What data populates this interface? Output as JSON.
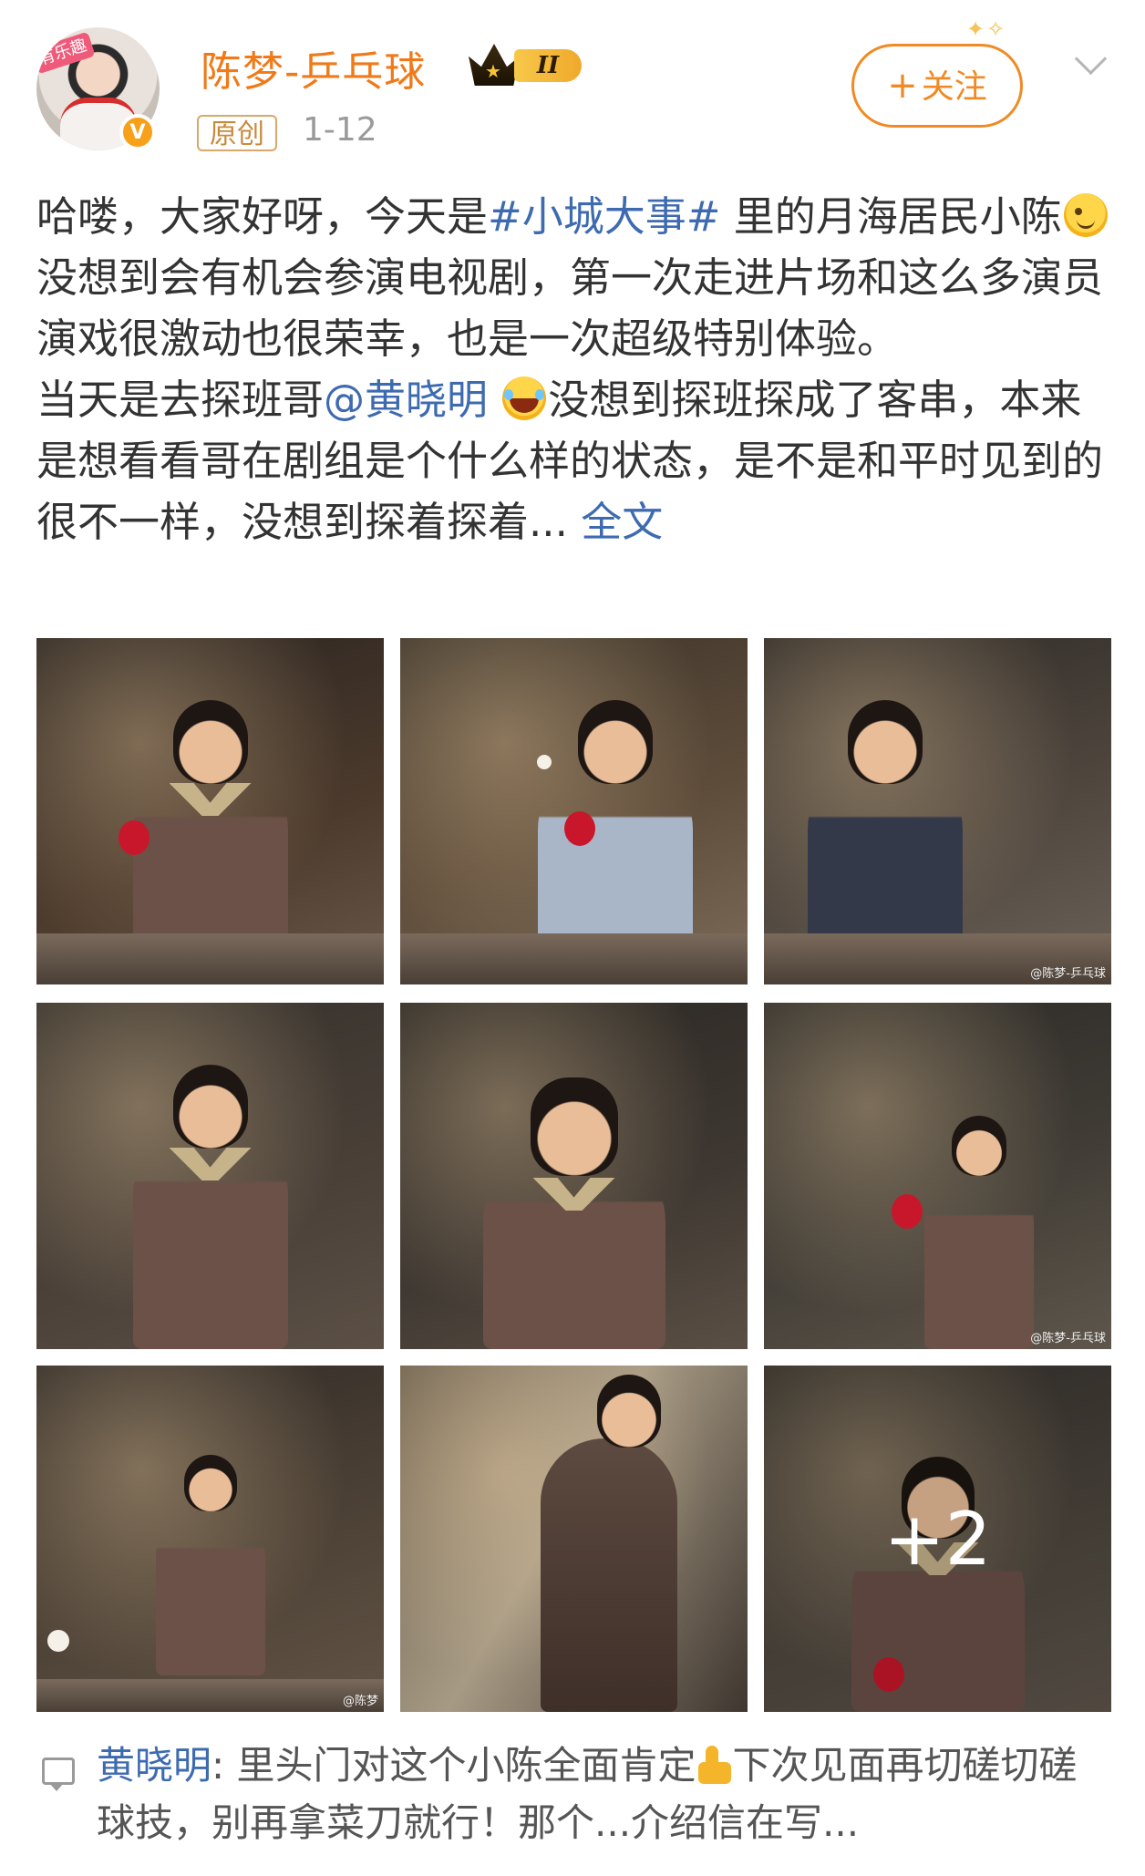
{
  "header": {
    "avatar_tag": "有乐趣",
    "username": "陈梦-乒乓球",
    "level": "II",
    "source_tag": "原创",
    "timestamp": "1-12",
    "follow_label": "关注",
    "follow_plus": "+"
  },
  "post": {
    "text_1": "哈喽，大家好呀，今天是",
    "topic": "#小城大事#",
    "text_2": " 里的月海居民小陈",
    "text_3": "没想到会有机会参演电视剧，第一次走进片场和这么多演员演戏很激动也很荣幸，也是一次超级特别体验。",
    "text_4": "当天是去探班哥",
    "mention": "@黄晓明",
    "text_5": "没想到探班探成了客串，本来是想看看哥在剧组是个什么样的状态，是不是和平时见到的很不一样，没想到探着探着...",
    "full_text_link": "全文"
  },
  "photos": {
    "watermark": "@陈梦-乒乓球",
    "watermark_short": "@陈梦",
    "more_count": "+2"
  },
  "comment": {
    "author": "黄晓明",
    "colon": ": ",
    "text_1": "里头门对这个小陈全面肯定",
    "text_2": "下次见面再切磋切磋球技，别再拿菜刀就行！那个...介绍信在写..."
  },
  "colors": {
    "username": "#f07a18",
    "link": "#3e6bb0",
    "follow": "#f08a24"
  }
}
